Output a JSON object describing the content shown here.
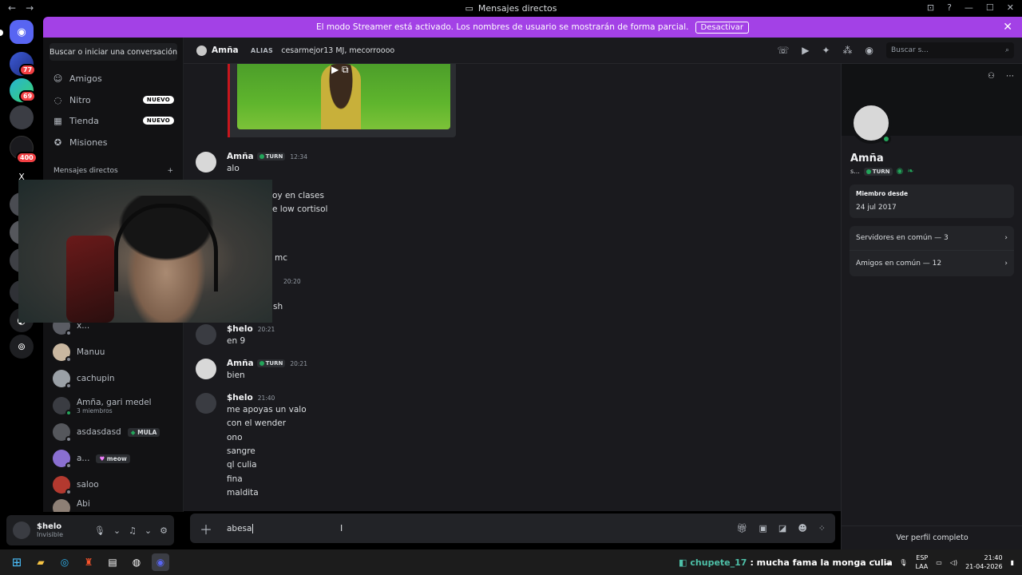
{
  "titlebar": {
    "title": "Mensajes directos"
  },
  "banner": {
    "text": "El modo Streamer está activado. Los nombres de usuario se mostrarán de forma parcial.",
    "button": "Desactivar"
  },
  "rail": {
    "badges": [
      "77",
      "69",
      "400"
    ],
    "letter": "X"
  },
  "sidebar": {
    "search": "Buscar o iniciar una conversación",
    "nav": [
      {
        "label": "Amigos",
        "icon": "friends-icon"
      },
      {
        "label": "Nitro",
        "icon": "nitro-icon",
        "badge": "NUEVO"
      },
      {
        "label": "Tienda",
        "icon": "shop-icon",
        "badge": "NUEVO"
      },
      {
        "label": "Misiones",
        "icon": "quests-icon"
      }
    ],
    "dm_header": "Mensajes directos",
    "dm_add": "+",
    "dms": [
      {
        "name": "x..."
      },
      {
        "name": "Manuu"
      },
      {
        "name": "cachupin"
      },
      {
        "name": "Amña, gari medel",
        "sub": "3 miembros"
      },
      {
        "name": "asdasdasd",
        "tag": "MULA"
      },
      {
        "name": "a...",
        "tag": "meow"
      },
      {
        "name": "saloo"
      },
      {
        "name": "Abi"
      }
    ]
  },
  "user": {
    "name": "$helo",
    "status": "Invisible"
  },
  "channel": {
    "name": "Amña",
    "alias_label": "ALIAS",
    "alias_value": "cesarmejor13 MJ, mecorroooo",
    "search_placeholder": "Buscar s..."
  },
  "messages": [
    {
      "author": "Amña",
      "tag": "TURN",
      "time": "12:34",
      "lines": [
        "alo"
      ]
    },
    {
      "partial_lines": [
        "oy en clases",
        "e low cortisol",
        "mc"
      ]
    },
    {
      "time": "20:20",
      "partial_lines": [
        "sh"
      ]
    },
    {
      "author": "$helo",
      "time": "20:21",
      "lines": [
        "en 9"
      ]
    },
    {
      "author": "Amña",
      "tag": "TURN",
      "time": "20:21",
      "lines": [
        "bien"
      ]
    },
    {
      "author": "$helo",
      "time": "21:40",
      "lines": [
        "me apoyas un valo",
        "con el wender",
        "ono",
        "sangre",
        "ql culia",
        "fina",
        "maldita"
      ]
    }
  ],
  "composer": {
    "value": "abesa"
  },
  "profile": {
    "name": "Amña",
    "short": "s...",
    "tag": "TURN",
    "member_since_label": "Miembro desde",
    "member_since": "24 jul 2017",
    "servers": "Servidores en común — 3",
    "friends": "Amigos en común — 12",
    "full": "Ver perfil completo"
  },
  "taskbar": {
    "ticker_user": "chupete_17",
    "ticker_msg": ": mucha fama la monga culia",
    "lang": "ESP",
    "layout": "LAA",
    "time": "21:40",
    "date": "21-04-2026"
  },
  "colors": {
    "banner": "#a341e6",
    "online": "#23a55a",
    "accent": "#5865f2",
    "badge": "#f23f43"
  }
}
